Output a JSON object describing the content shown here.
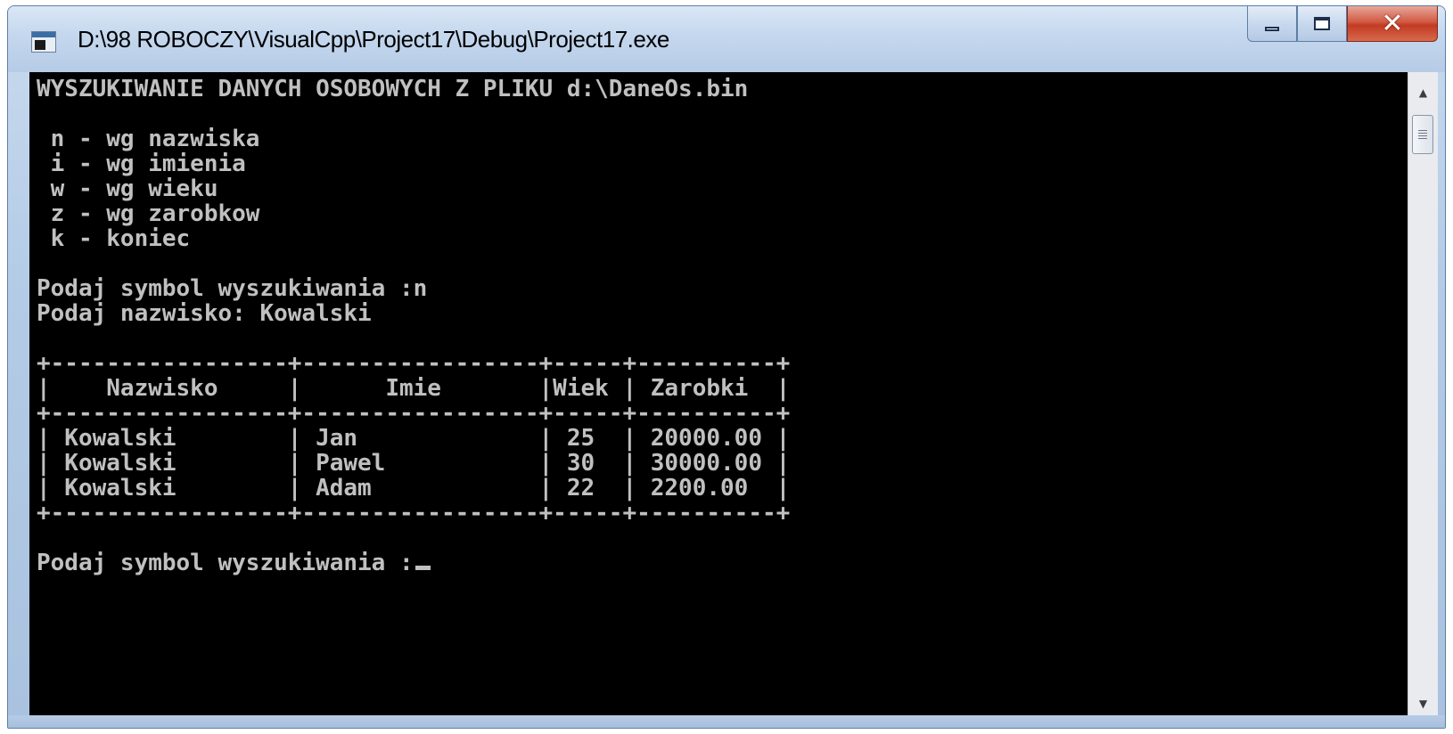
{
  "window": {
    "title": "D:\\98 ROBOCZY\\VisualCpp\\Project17\\Debug\\Project17.exe",
    "icon": "console-app-icon",
    "controls": {
      "minimize": "minimize-icon",
      "maximize": "maximize-icon",
      "close": "close-icon"
    }
  },
  "console": {
    "header": "WYSZUKIWANIE DANYCH OSOBOWYCH Z PLIKU d:\\DaneOs.bin",
    "menu": [
      " n - wg nazwiska",
      " i - wg imienia",
      " w - wg wieku",
      " z - wg zarobkow",
      " k - koniec"
    ],
    "prompt1": "Podaj symbol wyszukiwania :n",
    "prompt2": "Podaj nazwisko: Kowalski",
    "table": {
      "top_border": "+-----------------+-----------------+-----+----------+",
      "header_row": "|    Nazwisko     |      Imie       |Wiek | Zarobki  |",
      "mid_border": "+-----------------+-----------------+-----+----------+",
      "rows": [
        "| Kowalski        | Jan             | 25  | 20000.00 |",
        "| Kowalski        | Pawel           | 30  | 30000.00 |",
        "| Kowalski        | Adam            | 22  | 2200.00  |"
      ],
      "bottom_border": "+-----------------+-----------------+-----+----------+"
    },
    "prompt3": "Podaj symbol wyszukiwania :"
  }
}
